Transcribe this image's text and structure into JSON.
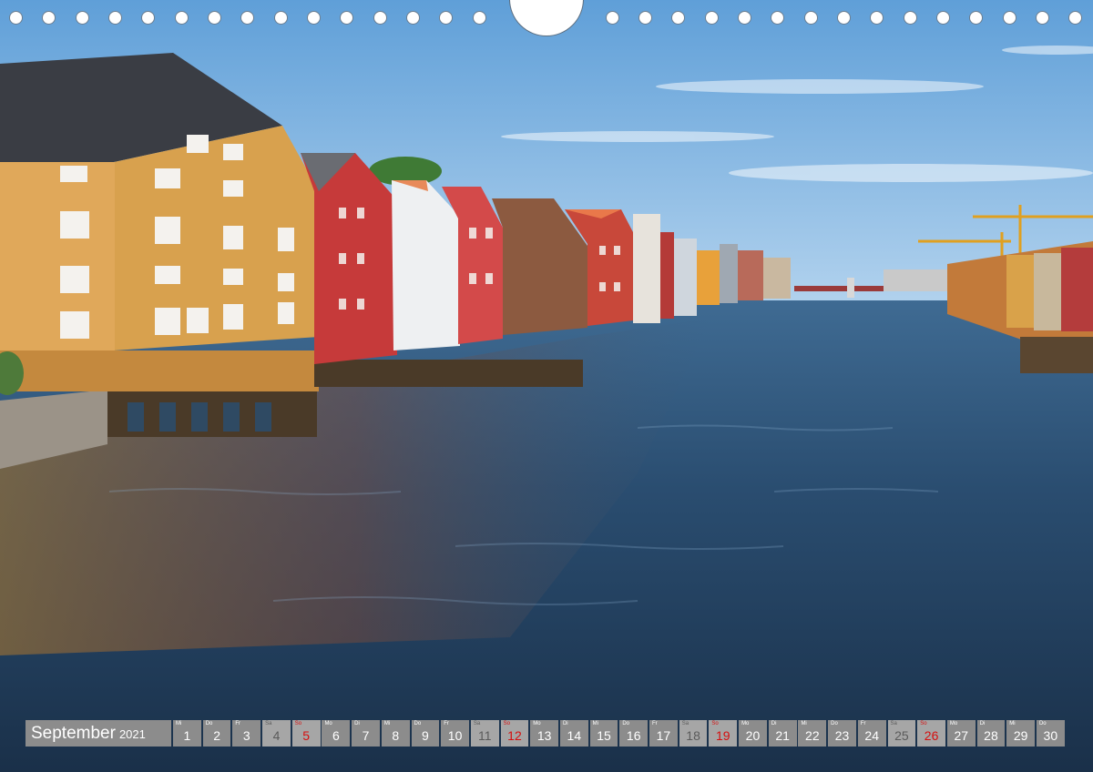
{
  "photo": {
    "subject": "",
    "colors": {
      "sky": "#7fb3e0",
      "water": "#26425e",
      "accent_red": "#d60f0f"
    }
  },
  "binding": {
    "icon": "spiral-binding-holes-icon",
    "hanger_icon": "hanger-cutout-icon"
  },
  "calendar": {
    "month": "September",
    "year": "2021",
    "days": [
      {
        "dow": "Mi",
        "num": "1",
        "type": "weekday"
      },
      {
        "dow": "Do",
        "num": "2",
        "type": "weekday"
      },
      {
        "dow": "Fr",
        "num": "3",
        "type": "weekday"
      },
      {
        "dow": "Sa",
        "num": "4",
        "type": "sat"
      },
      {
        "dow": "So",
        "num": "5",
        "type": "sun"
      },
      {
        "dow": "Mo",
        "num": "6",
        "type": "weekday"
      },
      {
        "dow": "Di",
        "num": "7",
        "type": "weekday"
      },
      {
        "dow": "Mi",
        "num": "8",
        "type": "weekday"
      },
      {
        "dow": "Do",
        "num": "9",
        "type": "weekday"
      },
      {
        "dow": "Fr",
        "num": "10",
        "type": "weekday"
      },
      {
        "dow": "Sa",
        "num": "11",
        "type": "sat"
      },
      {
        "dow": "So",
        "num": "12",
        "type": "sun"
      },
      {
        "dow": "Mo",
        "num": "13",
        "type": "weekday"
      },
      {
        "dow": "Di",
        "num": "14",
        "type": "weekday"
      },
      {
        "dow": "Mi",
        "num": "15",
        "type": "weekday"
      },
      {
        "dow": "Do",
        "num": "16",
        "type": "weekday"
      },
      {
        "dow": "Fr",
        "num": "17",
        "type": "weekday"
      },
      {
        "dow": "Sa",
        "num": "18",
        "type": "sat"
      },
      {
        "dow": "So",
        "num": "19",
        "type": "sun"
      },
      {
        "dow": "Mo",
        "num": "20",
        "type": "weekday"
      },
      {
        "dow": "Di",
        "num": "21",
        "type": "weekday"
      },
      {
        "dow": "Mi",
        "num": "22",
        "type": "weekday"
      },
      {
        "dow": "Do",
        "num": "23",
        "type": "weekday"
      },
      {
        "dow": "Fr",
        "num": "24",
        "type": "weekday"
      },
      {
        "dow": "Sa",
        "num": "25",
        "type": "sat"
      },
      {
        "dow": "So",
        "num": "26",
        "type": "sun"
      },
      {
        "dow": "Mo",
        "num": "27",
        "type": "weekday"
      },
      {
        "dow": "Di",
        "num": "28",
        "type": "weekday"
      },
      {
        "dow": "Mi",
        "num": "29",
        "type": "weekday"
      },
      {
        "dow": "Do",
        "num": "30",
        "type": "weekday"
      }
    ]
  }
}
